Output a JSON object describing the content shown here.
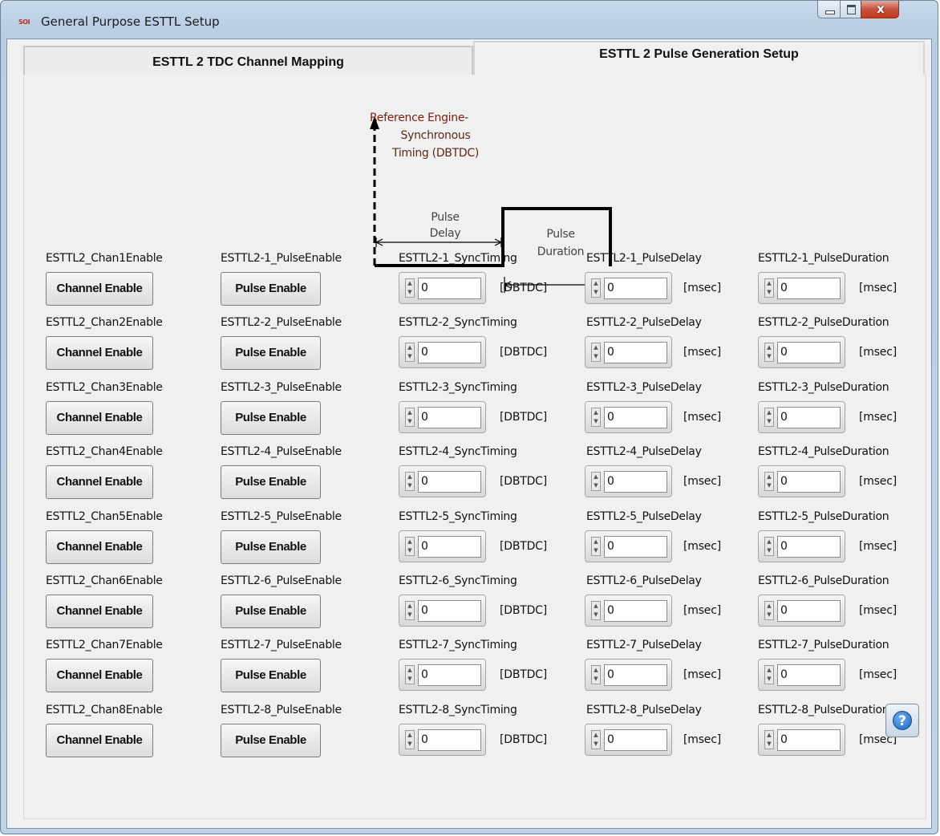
{
  "window": {
    "title": "General Purpose ESTTL Setup",
    "icon_text": "SOI",
    "close_glyph": "x"
  },
  "tabs": [
    {
      "label": "ESTTL 2 TDC Channel Mapping",
      "selected": false
    },
    {
      "label": "ESTTL 2 Pulse Generation Setup",
      "selected": true
    }
  ],
  "diagram": {
    "reference_label": [
      "Reference Engine-",
      "Synchronous",
      "Timing (DBTDC)"
    ],
    "pulse_delay_label": [
      "Pulse",
      "Delay"
    ],
    "pulse_duration_label": [
      "Pulse",
      "Duration"
    ]
  },
  "controls": {
    "channel_button_label": "Channel Enable",
    "pulse_button_label": "Pulse Enable",
    "sync_unit": "[DBTDC]",
    "delay_unit": "[msec]",
    "duration_unit": "[msec]"
  },
  "rows": [
    {
      "chan_label": "ESTTL2_Chan1Enable",
      "pulse_label": "ESTTL2-1_PulseEnable",
      "sync_label": "ESTTL2-1_SyncTiming",
      "delay_label": "ESTTL2-1_PulseDelay",
      "duration_label": "ESTTL2-1_PulseDuration",
      "sync_value": "0",
      "delay_value": "0",
      "duration_value": "0"
    },
    {
      "chan_label": "ESTTL2_Chan2Enable",
      "pulse_label": "ESTTL2-2_PulseEnable",
      "sync_label": "ESTTL2-2_SyncTiming",
      "delay_label": "ESTTL2-2_PulseDelay",
      "duration_label": "ESTTL2-2_PulseDuration",
      "sync_value": "0",
      "delay_value": "0",
      "duration_value": "0"
    },
    {
      "chan_label": "ESTTL2_Chan3Enable",
      "pulse_label": "ESTTL2-3_PulseEnable",
      "sync_label": "ESTTL2-3_SyncTiming",
      "delay_label": "ESTTL2-3_PulseDelay",
      "duration_label": "ESTTL2-3_PulseDuration",
      "sync_value": "0",
      "delay_value": "0",
      "duration_value": "0"
    },
    {
      "chan_label": "ESTTL2_Chan4Enable",
      "pulse_label": "ESTTL2-4_PulseEnable",
      "sync_label": "ESTTL2-4_SyncTiming",
      "delay_label": "ESTTL2-4_PulseDelay",
      "duration_label": "ESTTL2-4_PulseDuration",
      "sync_value": "0",
      "delay_value": "0",
      "duration_value": "0"
    },
    {
      "chan_label": "ESTTL2_Chan5Enable",
      "pulse_label": "ESTTL2-5_PulseEnable",
      "sync_label": "ESTTL2-5_SyncTiming",
      "delay_label": "ESTTL2-5_PulseDelay",
      "duration_label": "ESTTL2-5_PulseDuration",
      "sync_value": "0",
      "delay_value": "0",
      "duration_value": "0"
    },
    {
      "chan_label": "ESTTL2_Chan6Enable",
      "pulse_label": "ESTTL2-6_PulseEnable",
      "sync_label": "ESTTL2-6_SyncTiming",
      "delay_label": "ESTTL2-6_PulseDelay",
      "duration_label": "ESTTL2-6_PulseDuration",
      "sync_value": "0",
      "delay_value": "0",
      "duration_value": "0"
    },
    {
      "chan_label": "ESTTL2_Chan7Enable",
      "pulse_label": "ESTTL2-7_PulseEnable",
      "sync_label": "ESTTL2-7_SyncTiming",
      "delay_label": "ESTTL2-7_PulseDelay",
      "duration_label": "ESTTL2-7_PulseDuration",
      "sync_value": "0",
      "delay_value": "0",
      "duration_value": "0"
    },
    {
      "chan_label": "ESTTL2_Chan8Enable",
      "pulse_label": "ESTTL2-8_PulseEnable",
      "sync_label": "ESTTL2-8_SyncTiming",
      "delay_label": "ESTTL2-8_PulseDelay",
      "duration_label": "ESTTL2-8_PulseDuration",
      "sync_value": "0",
      "delay_value": "0",
      "duration_value": "0"
    }
  ],
  "help": {
    "glyph": "?"
  }
}
